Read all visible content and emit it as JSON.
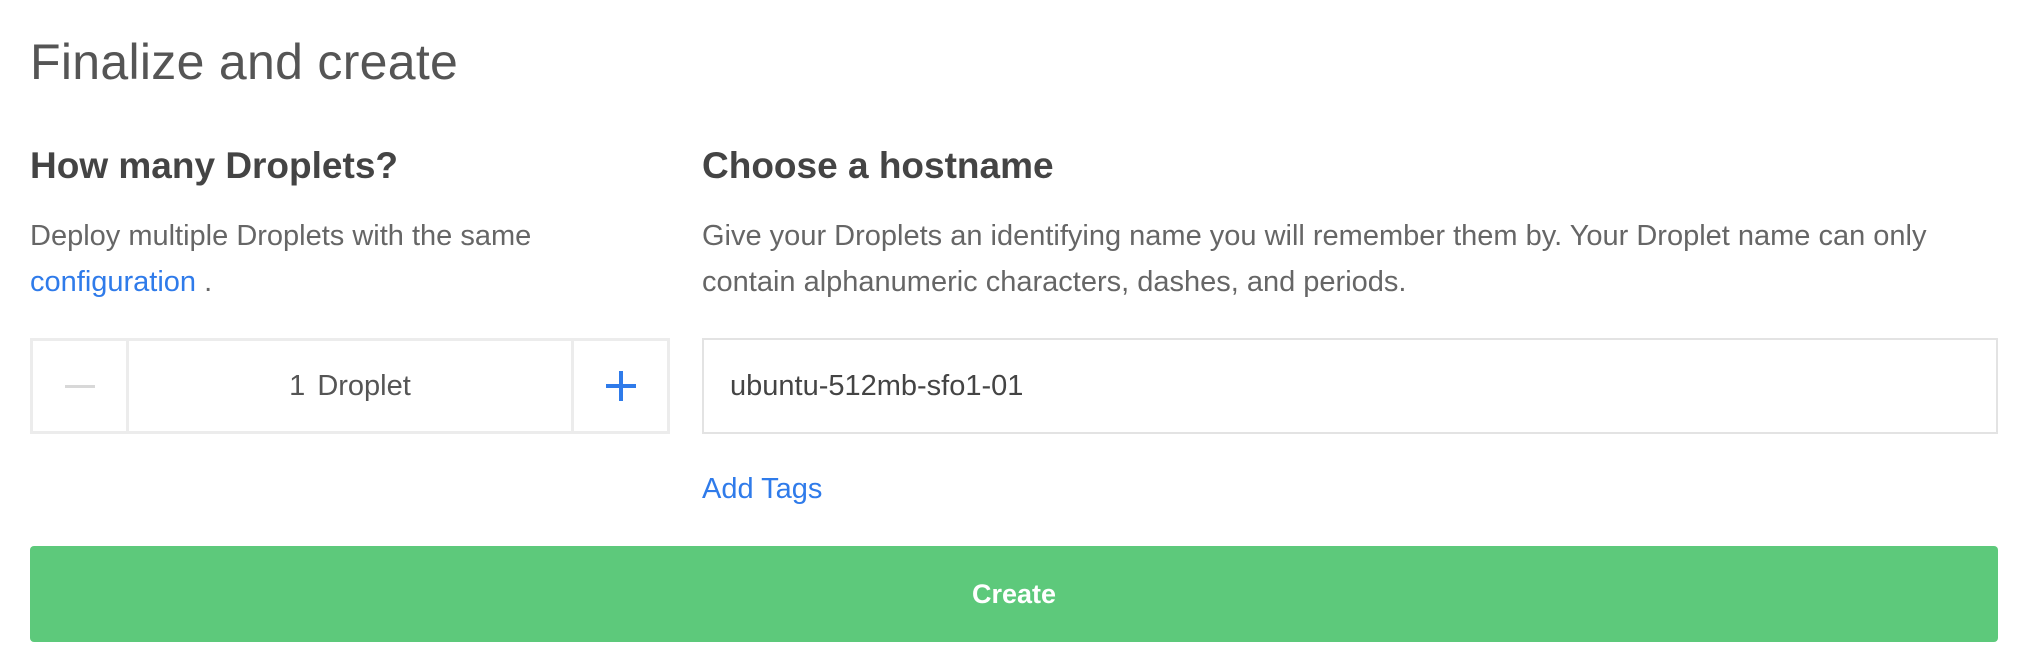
{
  "page": {
    "title": "Finalize and create"
  },
  "droplet_count": {
    "heading": "How many Droplets?",
    "description": "Deploy multiple Droplets with the same",
    "link_text": "configuration",
    "trailing_text": " .",
    "count_value": "1",
    "count_unit": "Droplet",
    "minus_icon": "minus-icon",
    "plus_icon": "plus-icon"
  },
  "hostname": {
    "heading": "Choose a hostname",
    "description": "Give your Droplets an identifying name you will remember them by. Your Droplet name can only contain alphanumeric characters, dashes, and periods.",
    "value": "ubuntu-512mb-sfo1-01",
    "add_tags_label": "Add Tags"
  },
  "actions": {
    "create_label": "Create"
  },
  "colors": {
    "accent_link": "#2f7bea",
    "create_button": "#5dc97b"
  }
}
